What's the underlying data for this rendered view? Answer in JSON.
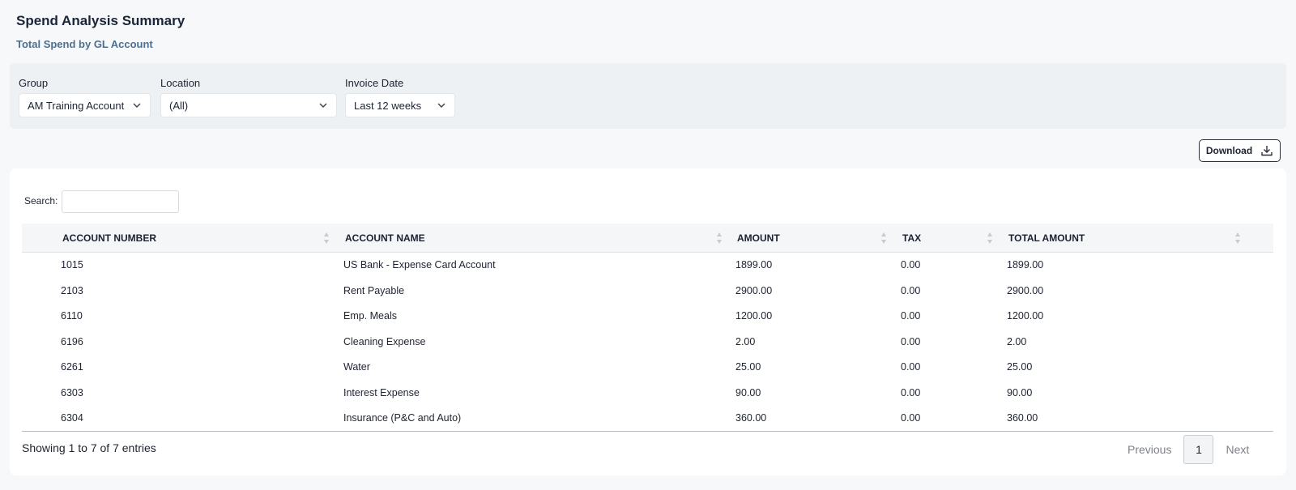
{
  "header": {
    "title": "Spend Analysis Summary",
    "subtitle": "Total Spend by GL Account"
  },
  "filters": {
    "group": {
      "label": "Group",
      "value": "AM Training Account"
    },
    "location": {
      "label": "Location",
      "value": "(All)"
    },
    "invoice_date": {
      "label": "Invoice Date",
      "value": "Last 12 weeks"
    }
  },
  "toolbar": {
    "download_label": "Download"
  },
  "table": {
    "search_label": "Search:",
    "search_value": "",
    "columns": [
      "ACCOUNT NUMBER",
      "ACCOUNT NAME",
      "AMOUNT",
      "TAX",
      "TOTAL AMOUNT"
    ],
    "rows": [
      [
        "1015",
        "US Bank - Expense Card Account",
        "1899.00",
        "0.00",
        "1899.00"
      ],
      [
        "2103",
        "Rent Payable",
        "2900.00",
        "0.00",
        "2900.00"
      ],
      [
        "6110",
        "Emp. Meals",
        "1200.00",
        "0.00",
        "1200.00"
      ],
      [
        "6196",
        "Cleaning Expense",
        "2.00",
        "0.00",
        "2.00"
      ],
      [
        "6261",
        "Water",
        "25.00",
        "0.00",
        "25.00"
      ],
      [
        "6303",
        "Interest Expense",
        "90.00",
        "0.00",
        "90.00"
      ],
      [
        "6304",
        "Insurance (P&C and Auto)",
        "360.00",
        "0.00",
        "360.00"
      ]
    ],
    "info": "Showing 1 to 7 of 7 entries"
  },
  "pagination": {
    "previous_label": "Previous",
    "current_page": "1",
    "next_label": "Next"
  },
  "icons": {
    "select": "chevron-down-icon",
    "sort": "sort-icon",
    "download": "download-icon"
  },
  "colors": {
    "subtitle": "#4f6e8e",
    "filter_panel_bg": "#edf1f4",
    "page_bg": "#f7f8fa"
  }
}
